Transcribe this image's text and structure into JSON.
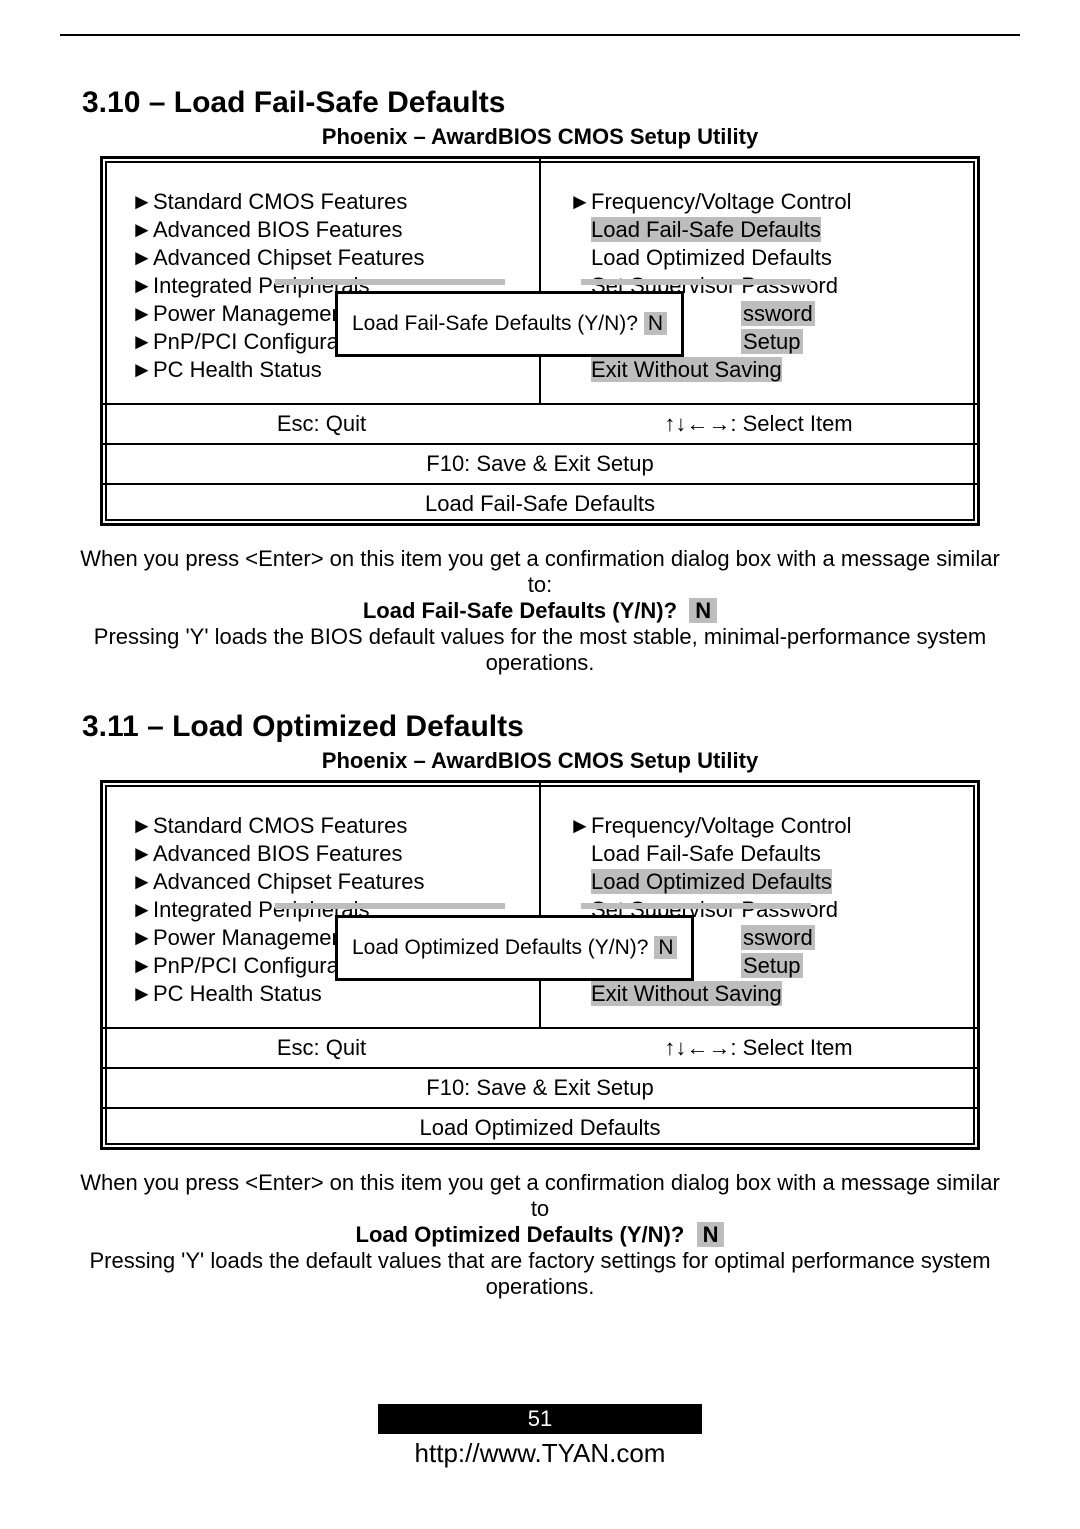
{
  "sections": {
    "s1_heading": "3.10 – Load Fail-Safe Defaults",
    "s2_heading": "3.11 – Load Optimized Defaults"
  },
  "bios": {
    "title": "Phoenix – AwardBIOS CMOS Setup Utility",
    "left": {
      "items": [
        {
          "arrow": "►",
          "label": "Standard CMOS Features"
        },
        {
          "arrow": "►",
          "label": "Advanced BIOS Features"
        },
        {
          "arrow": "►",
          "label": "Advanced Chipset Features"
        },
        {
          "arrow": "►",
          "label": "Integrated Peripherals"
        },
        {
          "arrow": "►",
          "label": "Power Management"
        },
        {
          "arrow": "►",
          "label": "PnP/PCI Configurati"
        },
        {
          "arrow": "►",
          "label": "PC Health Status"
        }
      ]
    },
    "right": {
      "items": [
        {
          "arrow": "►",
          "label": "Frequency/Voltage Control"
        },
        {
          "arrow": "",
          "label": "Load Fail-Safe Defaults"
        },
        {
          "arrow": "",
          "label": "Load Optimized Defaults"
        },
        {
          "arrow": "",
          "label": "Set Supervisor Password"
        },
        {
          "arrow": "",
          "label_tail": "ssword"
        },
        {
          "arrow": "",
          "label_tail": "Setup"
        },
        {
          "arrow": "",
          "label": "Exit Without Saving"
        }
      ]
    },
    "footer": {
      "esc": "Esc:  Quit",
      "nav": "↑↓←→: Select Item",
      "f10": "F10:  Save & Exit Setup"
    },
    "dialog1": {
      "text": "Load Fail-Safe Defaults (Y/N)?",
      "answer": "N",
      "help": "Load Fail-Safe Defaults"
    },
    "dialog2": {
      "text": "Load Optimized Defaults (Y/N)?",
      "answer": "N",
      "help": "Load Optimized Defaults"
    }
  },
  "explain1": {
    "line1": "When you press <Enter> on this item you get a confirmation dialog box with a message similar to:",
    "bold": "Load Fail-Safe Defaults (Y/N)?",
    "n": "N",
    "line2": "Pressing 'Y' loads the BIOS default values for the most stable, minimal-performance system operations."
  },
  "explain2": {
    "line1": "When you press <Enter> on this item you get a confirmation dialog box with a message similar to",
    "bold": "Load Optimized Defaults (Y/N)?",
    "n": "N",
    "line2": "Pressing 'Y' loads the default values that are factory settings for optimal performance system operations."
  },
  "page_footer": {
    "page_num": "51",
    "url": "http://www.TYAN.com"
  }
}
